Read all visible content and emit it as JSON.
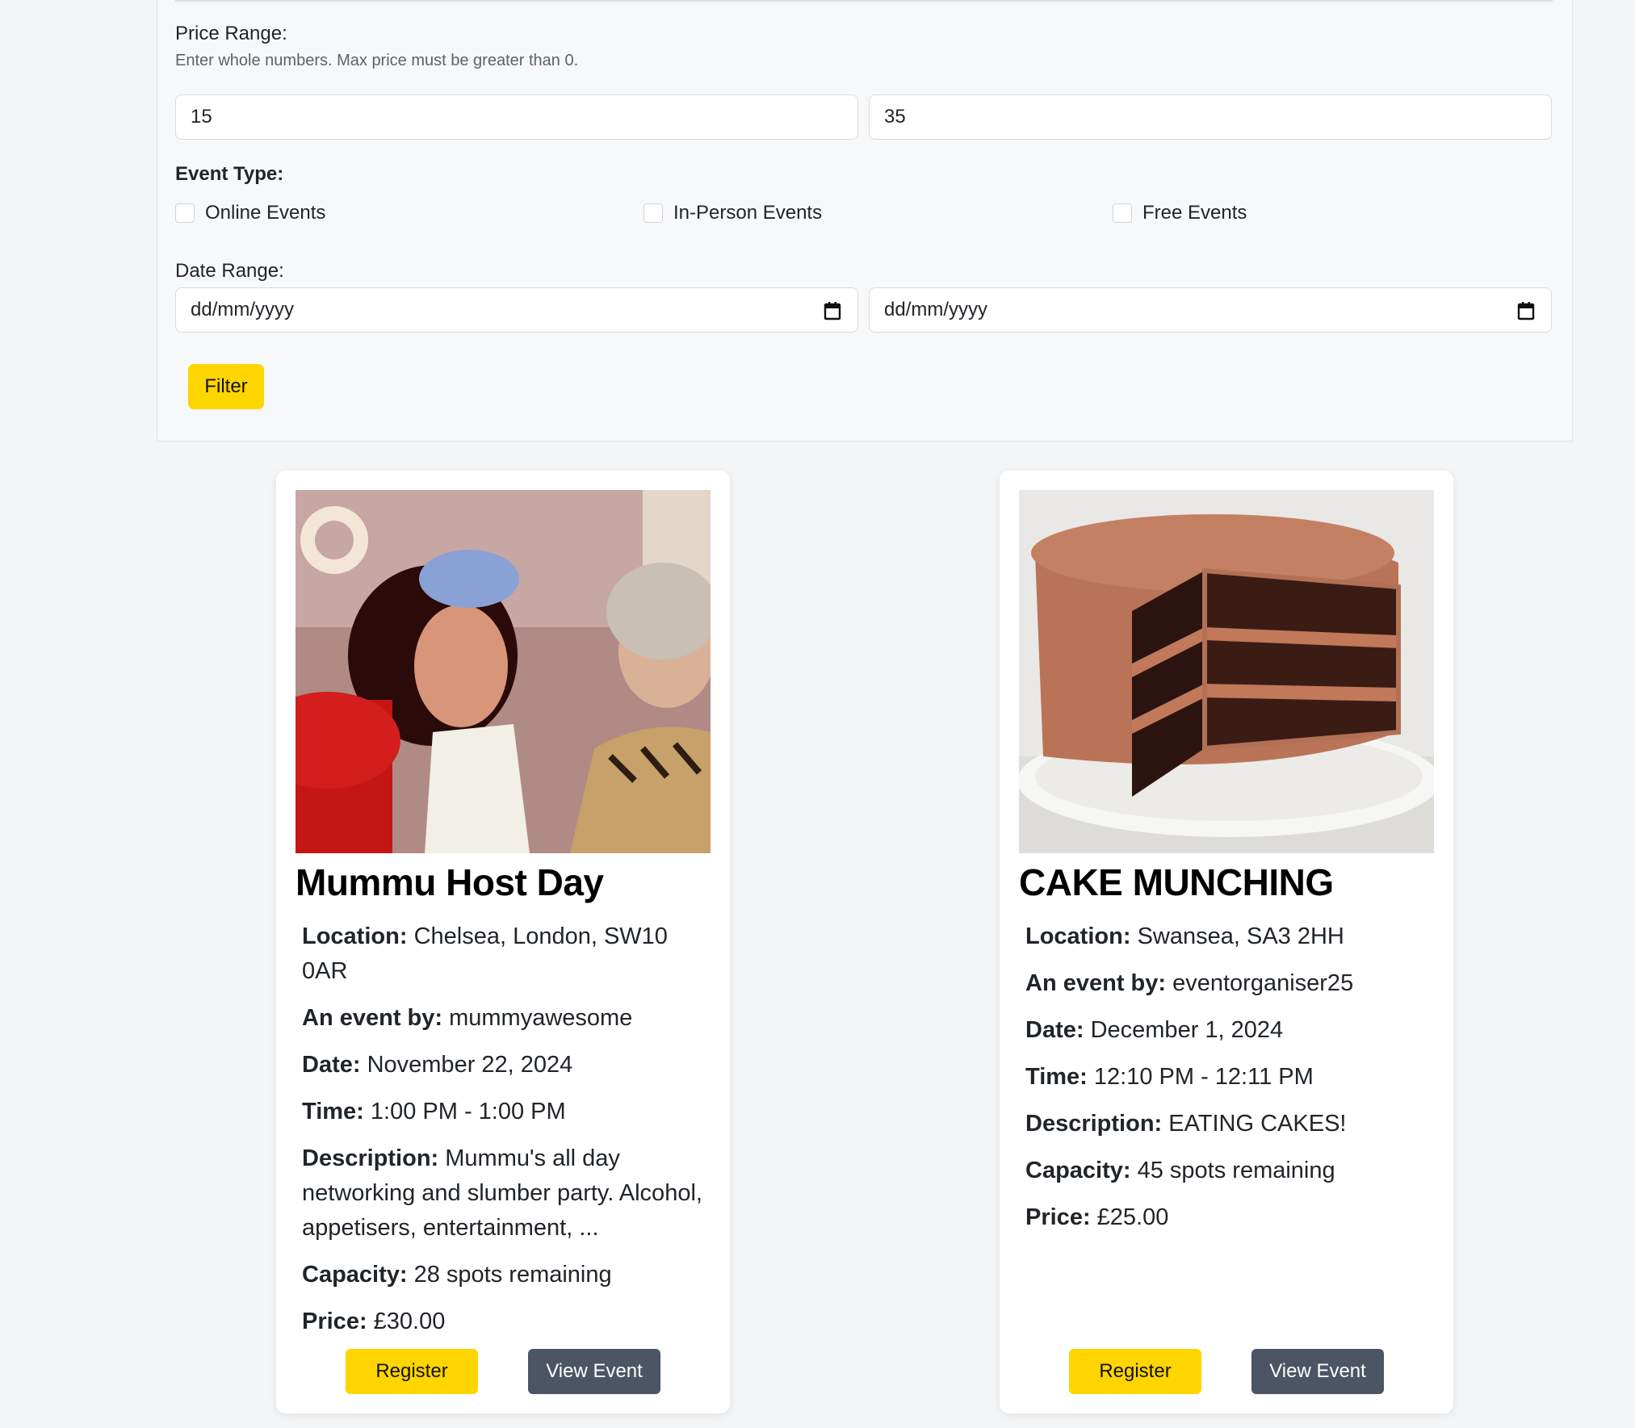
{
  "filters": {
    "price_label": "Price Range:",
    "price_help": "Enter whole numbers. Max price must be greater than 0.",
    "min_price": "15",
    "max_price": "35",
    "event_type_label": "Event Type:",
    "event_types": [
      {
        "label": "Online Events",
        "checked": false
      },
      {
        "label": "In-Person Events",
        "checked": false
      },
      {
        "label": "Free Events",
        "checked": false
      }
    ],
    "date_label": "Date Range:",
    "start_date": "dd/mm/yyyy",
    "end_date": "dd/mm/yyyy",
    "filter_button": "Filter"
  },
  "labels": {
    "location": "Location:",
    "organiser": "An event by:",
    "date": "Date:",
    "time": "Time:",
    "description": "Description:",
    "capacity": "Capacity:",
    "price": "Price:"
  },
  "events": [
    {
      "title": "Mummu Host Day",
      "location": "Chelsea, London, SW10 0AR",
      "organiser": "mummyawesome",
      "date": "November 22, 2024",
      "time": "1:00 PM - 1:00 PM",
      "description": "Mummu's all day networking and slumber party. Alcohol, appetisers, entertainment, ...",
      "capacity": "28 spots remaining",
      "price": "£30.00",
      "register_label": "Register",
      "view_label": "View Event"
    },
    {
      "title": "CAKE MUNCHING",
      "location": "Swansea, SA3 2HH",
      "organiser": "eventorganiser25",
      "date": "December 1, 2024",
      "time": "12:10 PM - 12:11 PM",
      "description": "EATING CAKES!",
      "capacity": "45 spots remaining",
      "price": "£25.00",
      "register_label": "Register",
      "view_label": "View Event"
    }
  ],
  "colors": {
    "accent": "#ffd500",
    "secondary_button": "#4b5563",
    "page_bg": "#f4f5f7"
  }
}
